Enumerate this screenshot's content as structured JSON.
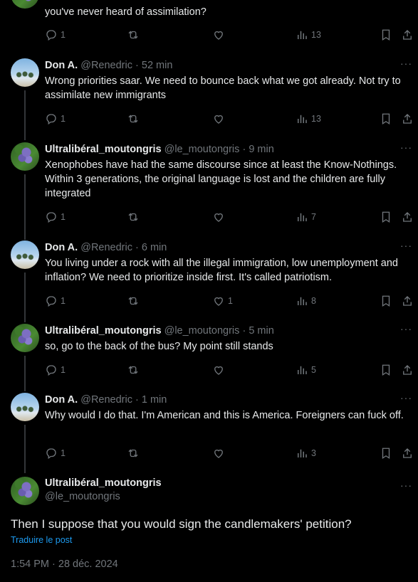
{
  "tweets": [
    {
      "name": "",
      "handle": "",
      "time": "",
      "text": "you've never heard of assimilation?",
      "avatar": "ultraliberal",
      "replies": "1",
      "retweets": "",
      "likes": "",
      "views": "13"
    },
    {
      "name": "Don A.",
      "handle": "@Renedric",
      "time": "52 min",
      "text": "Wrong priorities saar. We need to bounce back what we got already. Not try to assimilate new immigrants",
      "avatar": "don",
      "replies": "1",
      "retweets": "",
      "likes": "",
      "views": "13"
    },
    {
      "name": "Ultralibéral_moutongris",
      "handle": "@le_moutongris",
      "time": "9 min",
      "text": "Xenophobes have had the same discourse since at least the Know-Nothings. Within 3 generations, the original language is lost and the children are fully integrated",
      "avatar": "ultraliberal",
      "replies": "1",
      "retweets": "",
      "likes": "",
      "views": "7"
    },
    {
      "name": "Don A.",
      "handle": "@Renedric",
      "time": "6 min",
      "text": "You living under a rock with all the illegal immigration, low unemployment and inflation? We need to prioritize inside first. It's called patriotism.",
      "avatar": "don",
      "replies": "1",
      "retweets": "",
      "likes": "1",
      "views": "8"
    },
    {
      "name": "Ultralibéral_moutongris",
      "handle": "@le_moutongris",
      "time": "5 min",
      "text": "so, go to the back of the bus? My point still stands",
      "avatar": "ultraliberal",
      "replies": "1",
      "retweets": "",
      "likes": "",
      "views": "5"
    },
    {
      "name": "Don A.",
      "handle": "@Renedric",
      "time": "1 min",
      "text": "Why would I do that. I'm American and this is America. Foreigners can fuck off.",
      "avatar": "don",
      "replies": "1",
      "retweets": "",
      "likes": "",
      "views": "3"
    }
  ],
  "main": {
    "name": "Ultralibéral_moutongris",
    "handle": "@le_moutongris",
    "text": "Then I suppose that you would sign the candlemakers' petition?",
    "translate": "Traduire le post",
    "date": "1:54 PM · 28 déc. 2024"
  },
  "icons": [
    "reply-icon",
    "retweet-icon",
    "like-icon",
    "views-icon",
    "bookmark-icon",
    "share-icon",
    "more-icon"
  ],
  "colors": {
    "background": "#000000",
    "text": "#e7e9ea",
    "muted": "#71767b",
    "link": "#1d9bf0"
  }
}
